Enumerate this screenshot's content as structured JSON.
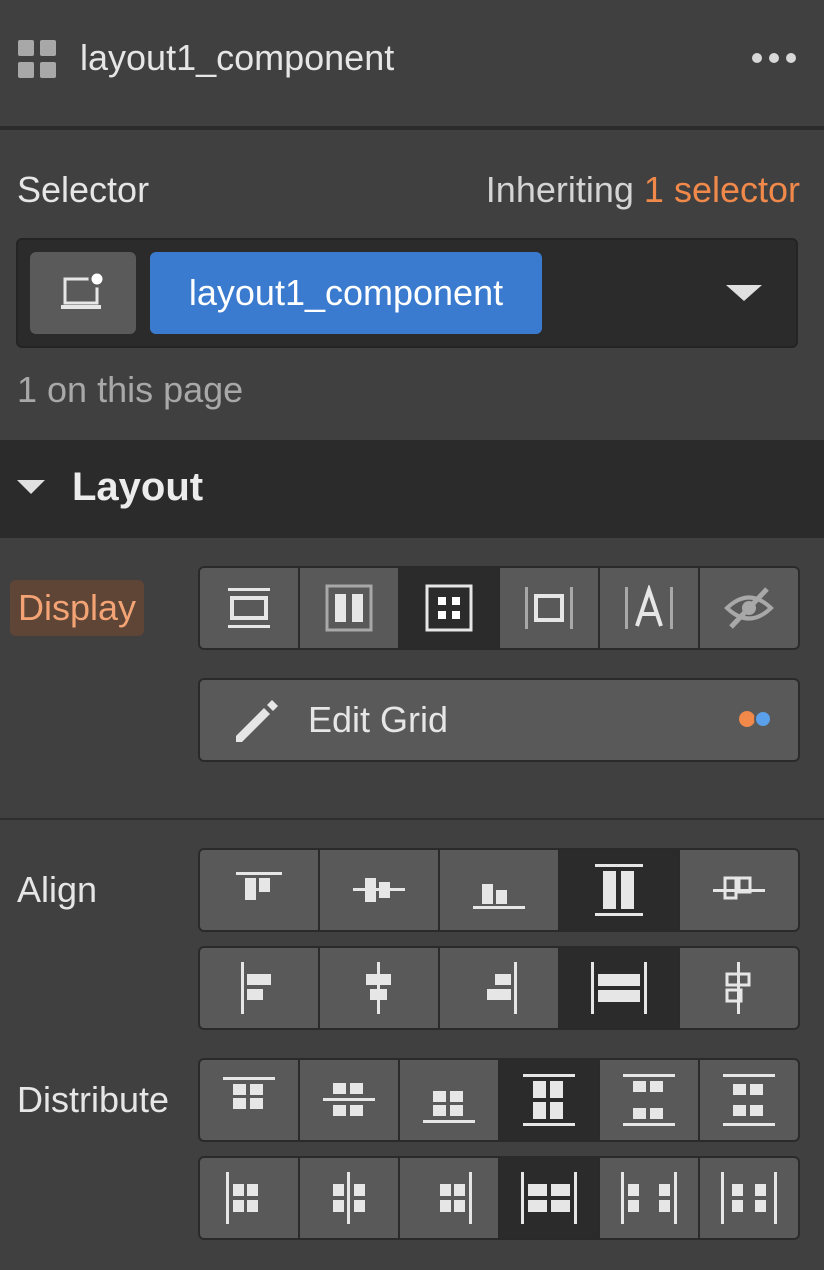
{
  "header": {
    "title": "layout1_component",
    "component_icon": "component-grid-icon",
    "more_icon": "more-dots-icon"
  },
  "selector": {
    "label": "Selector",
    "inheriting_prefix": "Inheriting",
    "inheriting_count": "1 selector",
    "device_icon": "device-state-icon",
    "chip": "layout1_component",
    "dropdown_icon": "caret-down-icon",
    "on_page": "1 on this page"
  },
  "layout": {
    "title": "Layout",
    "display_label": "Display",
    "display_options": [
      "block",
      "flex",
      "grid",
      "inline-block",
      "inline",
      "none"
    ],
    "display_selected": "grid",
    "edit_grid_label": "Edit Grid",
    "align_label": "Align",
    "distribute_label": "Distribute"
  },
  "colors": {
    "accent_orange": "#f0894a",
    "chip_blue": "#3a7bd0",
    "panel": "#404040",
    "dark": "#2b2b2b",
    "button": "#595959"
  }
}
